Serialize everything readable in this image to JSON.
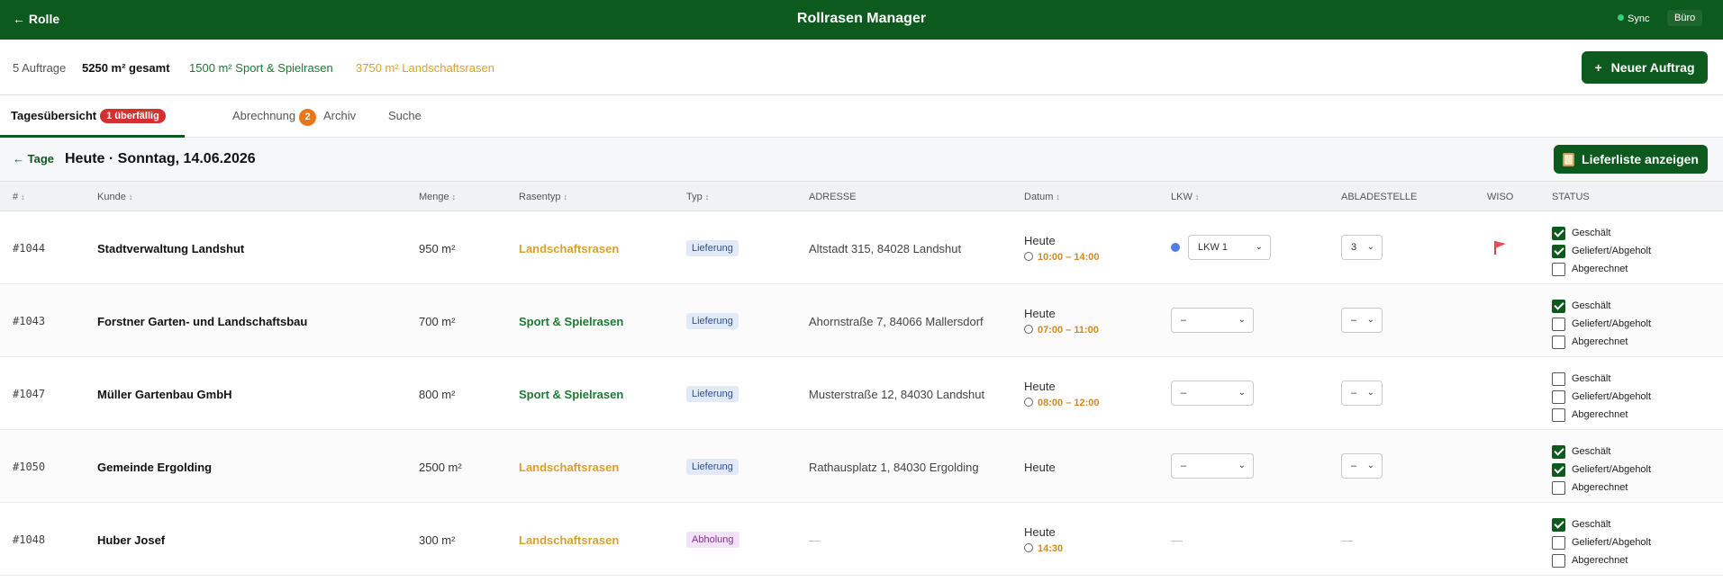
{
  "header": {
    "back_label": "← Rolle",
    "title": "Rollrasen Manager",
    "sync_label": "Sync",
    "office_label": "Büro"
  },
  "summary": {
    "count": "5 Auftrage",
    "total": "5250 m² gesamt",
    "sport": "1500 m² Sport & Spielrasen",
    "land": "3750 m² Landschaftsrasen",
    "new_button": "Neuer Auftrag",
    "new_button_icon": "+"
  },
  "tabs": [
    {
      "label": "Tagesübersicht",
      "badge": "1 überfällig",
      "active": true
    },
    {
      "label": "Abrechnung",
      "badge": "2"
    },
    {
      "label": "Archiv"
    },
    {
      "label": "Suche"
    }
  ],
  "day": {
    "back_label": "← Tage",
    "title": "Heute · Sonntag, 14.06.2026",
    "list_button": "Lieferliste anzeigen"
  },
  "columns": {
    "id": "#",
    "kunde": "Kunde",
    "menge": "Menge",
    "rasentyp": "Rasentyp",
    "typ": "Typ",
    "adresse": "ADRESSE",
    "datum": "Datum",
    "lkw": "LKW",
    "abladestelle": "ABLADESTELLE",
    "wiso": "WISO",
    "status": "STATUS",
    "sort_icon": "↕"
  },
  "status_labels": {
    "geschaelt": "Geschält",
    "geliefert": "Geliefert/Abgeholt",
    "abgerechnet": "Abgerechnet"
  },
  "rows": [
    {
      "id": "#1044",
      "kunde": "Stadtverwaltung Landshut",
      "menge": "950 m²",
      "rasentyp": "Landschaftsrasen",
      "typ": "Lieferung",
      "adresse": "Altstadt 315, 84028 Landshut",
      "datum": "Heute",
      "zeit": "10:00 – 14:00",
      "lkw": "LKW 1",
      "ablade": "3",
      "status": [
        true,
        true,
        false
      ]
    },
    {
      "id": "#1043",
      "kunde": "Forstner Garten- und Landschaftsbau",
      "menge": "700 m²",
      "rasentyp": "Sport & Spielrasen",
      "typ": "Lieferung",
      "adresse": "Ahornstraße 7, 84066 Mallersdorf",
      "datum": "Heute",
      "zeit": "07:00 – 11:00",
      "lkw": "–",
      "ablade": "–",
      "status": [
        true,
        false,
        false
      ]
    },
    {
      "id": "#1047",
      "kunde": "Müller Gartenbau GmbH",
      "menge": "800 m²",
      "rasentyp": "Sport & Spielrasen",
      "typ": "Lieferung",
      "adresse": "Musterstraße 12, 84030 Landshut",
      "datum": "Heute",
      "zeit": "08:00 – 12:00",
      "lkw": "–",
      "ablade": "–",
      "status": [
        false,
        false,
        false
      ]
    },
    {
      "id": "#1050",
      "kunde": "Gemeinde Ergolding",
      "menge": "2500 m²",
      "rasentyp": "Landschaftsrasen",
      "typ": "Lieferung",
      "adresse": "Rathausplatz 1, 84030 Ergolding",
      "datum": "Heute",
      "lkw": "–",
      "ablade": "–",
      "status": [
        true,
        true,
        false
      ]
    },
    {
      "id": "#1048",
      "kunde": "Huber Josef",
      "menge": "300 m²",
      "rasentyp": "Landschaftsrasen",
      "typ": "Abholung",
      "adresse": "—",
      "datum": "Heute",
      "zeit": "14:30",
      "lkw": "—",
      "ablade": "—",
      "status": [
        true,
        false,
        false
      ]
    }
  ],
  "colors": {
    "brand": "#0d5a1e",
    "sport": "#1a7a32",
    "land": "#d9a12a",
    "overdue": "#d3312f",
    "billing": "#e8771a"
  }
}
